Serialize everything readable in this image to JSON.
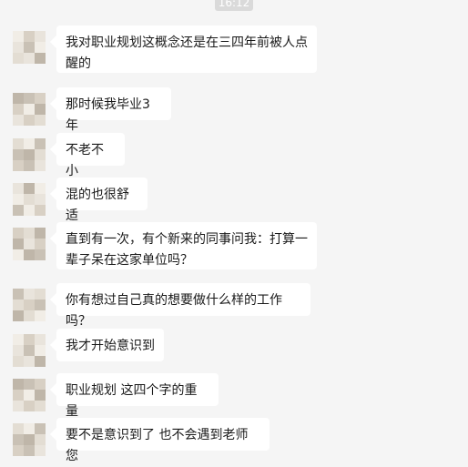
{
  "chat": {
    "timestamp": "16:12",
    "messages": [
      {
        "text": "我对职业规划这概念还是在三四年前被人点醒的"
      },
      {
        "text": "那时候我毕业3年"
      },
      {
        "text": "不老不小"
      },
      {
        "text": "混的也很舒适"
      },
      {
        "text": "直到有一次，有个新来的同事问我：打算一辈子呆在这家单位吗？"
      },
      {
        "text": "你有想过自己真的想要做什么样的工作吗？"
      },
      {
        "text": "我才开始意识到"
      },
      {
        "text": "职业规划 这四个字的重量"
      },
      {
        "text": "要不是意识到了 也不会遇到老师您"
      }
    ]
  },
  "colors": {
    "background": "#f5f5f5",
    "bubble": "#ffffff",
    "timestamp_bg": "#dadada",
    "avatar_palette": [
      "#e9e4dc",
      "#d8d0c4",
      "#c9c1b5",
      "#f1ede6",
      "#bfb6a9",
      "#e3ddd3"
    ]
  }
}
